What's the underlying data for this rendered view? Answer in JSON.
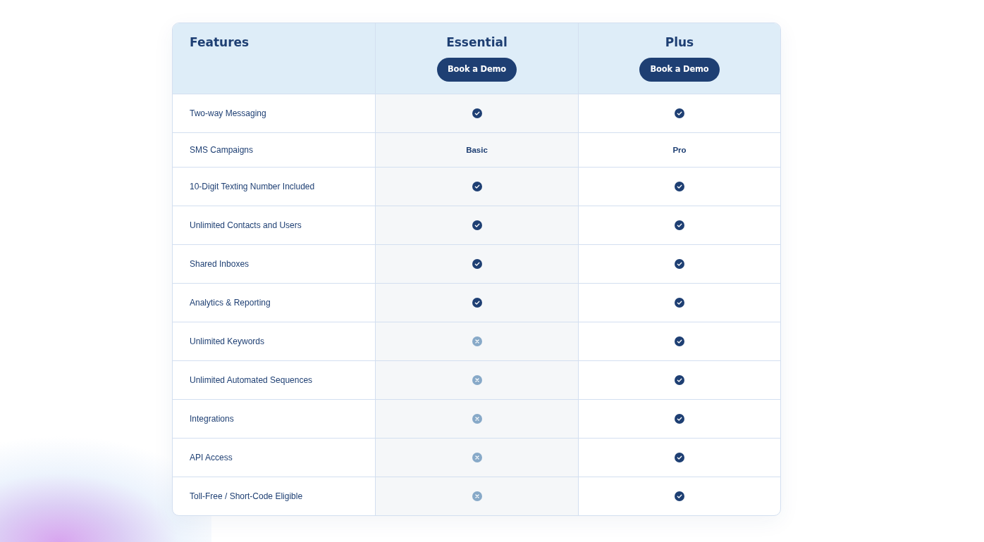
{
  "table": {
    "columns": [
      {
        "title": "Features"
      },
      {
        "title": "Essential",
        "button": "Book a Demo"
      },
      {
        "title": "Plus",
        "button": "Book a Demo"
      }
    ],
    "rows": [
      {
        "feature": "Two-way Messaging",
        "values": [
          {
            "kind": "icon",
            "included": true
          },
          {
            "kind": "icon",
            "included": true
          }
        ]
      },
      {
        "feature": "SMS Campaigns",
        "values": [
          {
            "kind": "text",
            "text": "Basic"
          },
          {
            "kind": "text",
            "text": "Pro"
          }
        ]
      },
      {
        "feature": "10-Digit Texting Number Included",
        "values": [
          {
            "kind": "icon",
            "included": true
          },
          {
            "kind": "icon",
            "included": true
          }
        ]
      },
      {
        "feature": "Unlimited Contacts and Users",
        "values": [
          {
            "kind": "icon",
            "included": true
          },
          {
            "kind": "icon",
            "included": true
          }
        ]
      },
      {
        "feature": "Shared Inboxes",
        "values": [
          {
            "kind": "icon",
            "included": true
          },
          {
            "kind": "icon",
            "included": true
          }
        ]
      },
      {
        "feature": "Analytics & Reporting",
        "values": [
          {
            "kind": "icon",
            "included": true
          },
          {
            "kind": "icon",
            "included": true
          }
        ]
      },
      {
        "feature": "Unlimited Keywords",
        "values": [
          {
            "kind": "icon",
            "included": false
          },
          {
            "kind": "icon",
            "included": true
          }
        ]
      },
      {
        "feature": "Unlimited Automated Sequences",
        "values": [
          {
            "kind": "icon",
            "included": false
          },
          {
            "kind": "icon",
            "included": true
          }
        ]
      },
      {
        "feature": "Integrations",
        "values": [
          {
            "kind": "icon",
            "included": false
          },
          {
            "kind": "icon",
            "included": true
          }
        ]
      },
      {
        "feature": "API Access",
        "values": [
          {
            "kind": "icon",
            "included": false
          },
          {
            "kind": "icon",
            "included": true
          }
        ]
      },
      {
        "feature": "Toll-Free / Short-Code Eligible",
        "values": [
          {
            "kind": "icon",
            "included": false
          },
          {
            "kind": "icon",
            "included": true
          }
        ]
      }
    ]
  }
}
